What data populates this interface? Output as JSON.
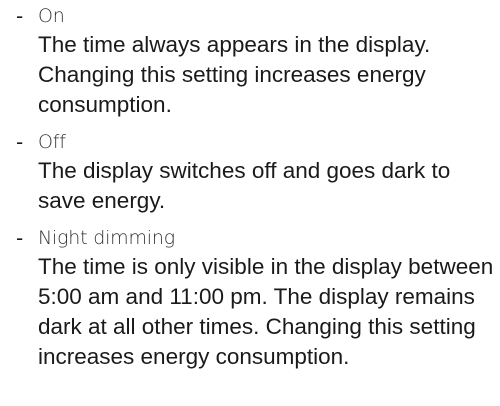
{
  "items": [
    {
      "bullet": "-",
      "term": "On",
      "description": "The time always appears in the display. Changing this setting increases energy consumption."
    },
    {
      "bullet": "-",
      "term": "Off",
      "description": "The display switches off and goes dark to save energy."
    },
    {
      "bullet": "-",
      "term": "Night dimming",
      "description": "The time is only visible in the display between 5:00 am and 11:00 pm. The display remains dark at all other times. Changing this setting increases energy consumption."
    }
  ]
}
